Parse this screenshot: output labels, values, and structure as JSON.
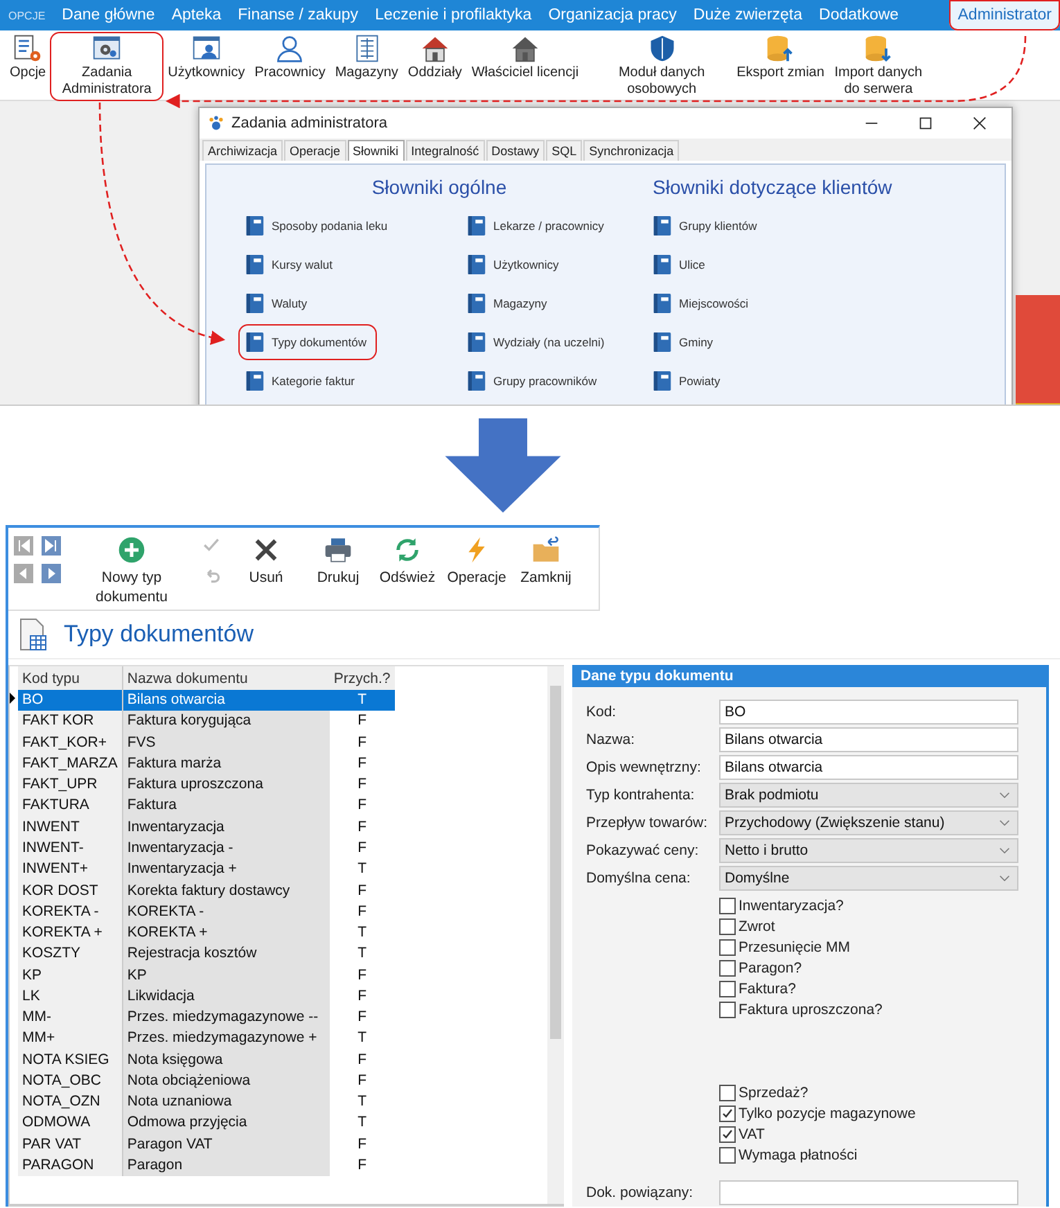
{
  "menu_bar": {
    "logo": "OPCJE",
    "tabs": [
      {
        "label": "Dane główne",
        "selected": false,
        "highlighted": false
      },
      {
        "label": "Apteka",
        "selected": false,
        "highlighted": false
      },
      {
        "label": "Finanse / zakupy",
        "selected": false,
        "highlighted": false
      },
      {
        "label": "Leczenie i profilaktyka",
        "selected": false,
        "highlighted": false
      },
      {
        "label": "Organizacja pracy",
        "selected": false,
        "highlighted": false
      },
      {
        "label": "Duże zwierzęta",
        "selected": false,
        "highlighted": false
      },
      {
        "label": "Dodatkowe",
        "selected": false,
        "highlighted": false
      },
      {
        "label": "Administrator",
        "selected": true,
        "highlighted": true
      }
    ]
  },
  "ribbon": {
    "buttons": [
      {
        "label": "Opcje",
        "kind": "options",
        "highlighted": false
      },
      {
        "label": "Zadania Administratora",
        "kind": "admin-tasks",
        "highlighted": true
      },
      {
        "label": "Użytkownicy",
        "kind": "users",
        "highlighted": false
      },
      {
        "label": "Pracownicy",
        "kind": "staff",
        "highlighted": false
      },
      {
        "label": "Magazyny",
        "kind": "warehouses",
        "highlighted": false
      },
      {
        "label": "Oddziały",
        "kind": "branches",
        "highlighted": false
      },
      {
        "label": "Właściciel licencji",
        "kind": "owner",
        "highlighted": false
      },
      {
        "label": "Moduł danych osobowych",
        "kind": "privacy",
        "highlighted": false
      },
      {
        "label": "Eksport zmian",
        "kind": "export",
        "highlighted": false
      },
      {
        "label": "Import danych do serwera",
        "kind": "import",
        "highlighted": false
      }
    ]
  },
  "dialog": {
    "title": "Zadania administratora",
    "tabs": [
      {
        "label": "Archiwizacja",
        "selected": false
      },
      {
        "label": "Operacje",
        "selected": false
      },
      {
        "label": "Słowniki",
        "selected": true
      },
      {
        "label": "Integralność",
        "selected": false
      },
      {
        "label": "Dostawy",
        "selected": false
      },
      {
        "label": "SQL",
        "selected": false
      },
      {
        "label": "Synchronizacja",
        "selected": false
      }
    ],
    "sections": [
      {
        "title": "Słowniki ogólne",
        "columns": [
          [
            {
              "label": "Sposoby podania leku",
              "highlighted": false
            },
            {
              "label": "Kursy walut",
              "highlighted": false
            },
            {
              "label": "Waluty",
              "highlighted": false
            },
            {
              "label": "Typy dokumentów",
              "highlighted": true
            },
            {
              "label": "Kategorie faktur",
              "highlighted": false
            }
          ],
          [
            {
              "label": "Lekarze / pracownicy",
              "highlighted": false
            },
            {
              "label": "Użytkownicy",
              "highlighted": false
            },
            {
              "label": "Magazyny",
              "highlighted": false
            },
            {
              "label": "Wydziały (na uczelni)",
              "highlighted": false
            },
            {
              "label": "Grupy pracowników",
              "highlighted": false
            }
          ]
        ]
      },
      {
        "title": "Słowniki dotyczące klientów",
        "columns": [
          [
            {
              "label": "Grupy klientów",
              "highlighted": false
            },
            {
              "label": "Ulice",
              "highlighted": false
            },
            {
              "label": "Miejscowości",
              "highlighted": false
            },
            {
              "label": "Gminy",
              "highlighted": false
            },
            {
              "label": "Powiaty",
              "highlighted": false
            }
          ]
        ]
      }
    ]
  },
  "editor": {
    "toolbar": [
      {
        "kind": "add",
        "label": "Nowy typ dokumentu"
      },
      {
        "kind": "edit-stack",
        "actions": [
          {
            "kind": "confirm",
            "disabled": true
          },
          {
            "kind": "undo",
            "disabled": true
          }
        ]
      },
      {
        "kind": "delete",
        "label": "Usuń"
      },
      {
        "kind": "print",
        "label": "Drukuj"
      },
      {
        "kind": "refresh",
        "label": "Odśwież"
      },
      {
        "kind": "operations",
        "label": "Operacje"
      },
      {
        "kind": "close",
        "label": "Zamknij"
      }
    ],
    "title": "Typy dokumentów",
    "table": {
      "columns": [
        "Kod typu",
        "Nazwa dokumentu",
        "Przych.?"
      ],
      "rows": [
        {
          "cells": [
            "BO",
            "Bilans otwarcia",
            "T"
          ],
          "selected": true
        },
        {
          "cells": [
            "FAKT KOR",
            "Faktura korygująca",
            "F"
          ],
          "selected": false
        },
        {
          "cells": [
            "FAKT_KOR+",
            "FVS",
            "F"
          ],
          "selected": false
        },
        {
          "cells": [
            "FAKT_MARZA",
            "Faktura marża",
            "F"
          ],
          "selected": false
        },
        {
          "cells": [
            "FAKT_UPR",
            "Faktura uproszczona",
            "F"
          ],
          "selected": false
        },
        {
          "cells": [
            "FAKTURA",
            "Faktura",
            "F"
          ],
          "selected": false
        },
        {
          "cells": [
            "INWENT",
            "Inwentaryzacja",
            "F"
          ],
          "selected": false
        },
        {
          "cells": [
            "INWENT-",
            "Inwentaryzacja -",
            "F"
          ],
          "selected": false
        },
        {
          "cells": [
            "INWENT+",
            "Inwentaryzacja +",
            "T"
          ],
          "selected": false
        },
        {
          "cells": [
            "KOR DOST",
            "Korekta faktury dostawcy",
            "F"
          ],
          "selected": false
        },
        {
          "cells": [
            "KOREKTA -",
            "KOREKTA -",
            "F"
          ],
          "selected": false
        },
        {
          "cells": [
            "KOREKTA +",
            "KOREKTA +",
            "T"
          ],
          "selected": false
        },
        {
          "cells": [
            "KOSZTY",
            "Rejestracja kosztów",
            "T"
          ],
          "selected": false
        },
        {
          "cells": [
            "KP",
            "KP",
            "F"
          ],
          "selected": false
        },
        {
          "cells": [
            "LK",
            "Likwidacja",
            "F"
          ],
          "selected": false
        },
        {
          "cells": [
            "MM-",
            "Przes. miedzymagazynowe --",
            "F"
          ],
          "selected": false
        },
        {
          "cells": [
            "MM+",
            "Przes. miedzymagazynowe +",
            "T"
          ],
          "selected": false
        },
        {
          "cells": [
            "NOTA KSIEG",
            "Nota księgowa",
            "F"
          ],
          "selected": false
        },
        {
          "cells": [
            "NOTA_OBC",
            "Nota obciążeniowa",
            "F"
          ],
          "selected": false
        },
        {
          "cells": [
            "NOTA_OZN",
            "Nota uznaniowa",
            "T"
          ],
          "selected": false
        },
        {
          "cells": [
            "ODMOWA",
            "Odmowa przyjęcia",
            "T"
          ],
          "selected": false
        },
        {
          "cells": [
            "PAR VAT",
            "Paragon VAT",
            "F"
          ],
          "selected": false
        },
        {
          "cells": [
            "PARAGON",
            "Paragon",
            "F"
          ],
          "selected": false
        }
      ]
    },
    "details": {
      "title": "Dane typu dokumentu",
      "fields": [
        {
          "label": "Kod:",
          "kind": "text",
          "value": "BO"
        },
        {
          "label": "Nazwa:",
          "kind": "text",
          "value": "Bilans otwarcia"
        },
        {
          "label": "Opis wewnętrzny:",
          "kind": "text",
          "value": "Bilans otwarcia"
        },
        {
          "label": "Typ kontrahenta:",
          "kind": "select",
          "value": "Brak podmiotu"
        },
        {
          "label": "Przepływ towarów:",
          "kind": "select",
          "value": "Przychodowy (Zwiększenie stanu)"
        },
        {
          "label": "Pokazywać ceny:",
          "kind": "select",
          "value": "Netto i brutto"
        },
        {
          "label": "Domyślna cena:",
          "kind": "select",
          "value": "Domyślne"
        }
      ],
      "checkboxes_top": [
        {
          "label": "Inwentaryzacja?",
          "checked": false
        },
        {
          "label": "Zwrot",
          "checked": false
        },
        {
          "label": "Przesunięcie MM",
          "checked": false
        },
        {
          "label": "Paragon?",
          "checked": false
        },
        {
          "label": "Faktura?",
          "checked": false
        },
        {
          "label": "Faktura uproszczona?",
          "checked": false
        }
      ],
      "checkboxes_bottom": [
        {
          "label": "Sprzedaż?",
          "checked": false
        },
        {
          "label": "Tylko pozycje magazynowe",
          "checked": true
        },
        {
          "label": "VAT",
          "checked": true
        },
        {
          "label": "Wymaga płatności",
          "checked": false
        }
      ],
      "linked_field": {
        "label": "Dok. powiązany:",
        "kind": "text"
      }
    }
  }
}
